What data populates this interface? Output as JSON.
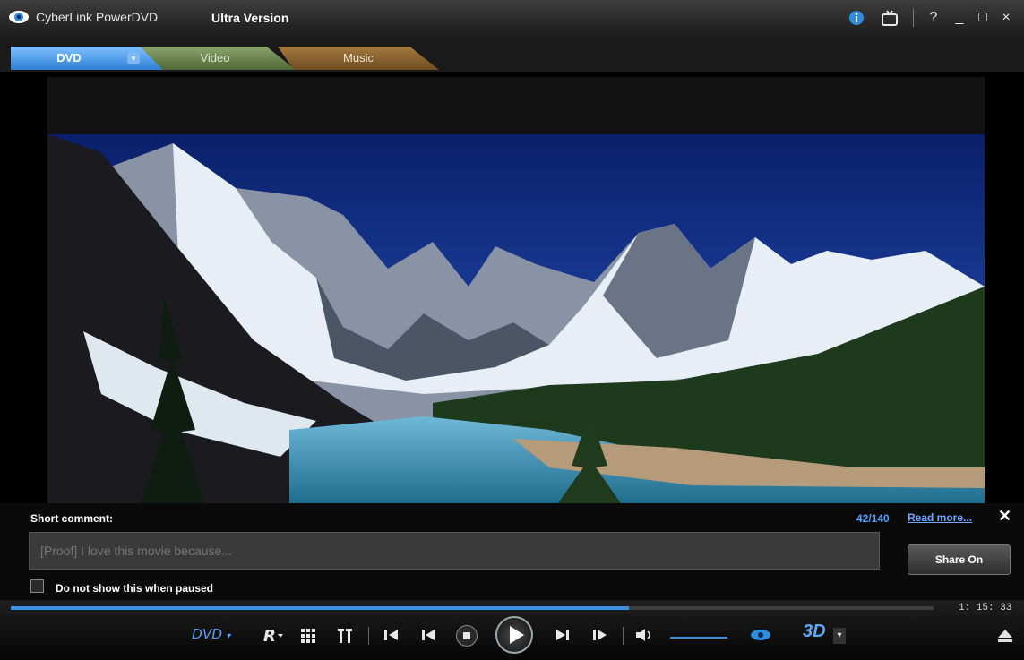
{
  "window": {
    "app_title": "CyberLink PowerDVD",
    "edition": "Ultra Version",
    "icons": {
      "logo": "eye-logo-icon",
      "info": "info-icon",
      "mode": "tv-mode-icon",
      "help": "help-icon",
      "minimize": "minimize-icon",
      "maximize": "maximize-icon",
      "close": "close-icon"
    },
    "help_label": "?",
    "minimize_label": "_",
    "maximize_label": "□",
    "close_label": "×"
  },
  "tabs": [
    {
      "label": "DVD",
      "active": true
    },
    {
      "label": "Video",
      "active": false
    },
    {
      "label": "Music",
      "active": false
    }
  ],
  "colors": {
    "accent": "#3c8fe2",
    "tab_dvd": "#4a9af0",
    "tab_video": "#6c8450",
    "tab_music": "#8a6230"
  },
  "comment": {
    "label": "Short comment:",
    "counter": "42/140",
    "read_more": "Read more...",
    "close": "✕",
    "placeholder": "[Proof] I love this movie because...",
    "share_button": "Share On",
    "checkbox_label": "Do not show this when paused",
    "checkbox_checked": false
  },
  "playback": {
    "timecode": "1: 15: 33",
    "progress_fraction": 0.67,
    "volume_fraction": 0.7,
    "source_label": "DVD",
    "source_caret": "▾",
    "three_d_label": "3D",
    "controls": {
      "bookmark": "bookmark-icon",
      "chapters": "chapters-grid-icon",
      "subtitles": "subtitles-icon",
      "step_back": "step-back-icon",
      "previous": "previous-chapter-icon",
      "stop": "stop-icon",
      "play": "play-icon",
      "next": "next-chapter-icon",
      "step_forward": "step-forward-icon",
      "volume": "volume-icon",
      "trueview": "trueview-eye-icon",
      "three_d": "3d-icon",
      "eject": "eject-icon"
    }
  }
}
